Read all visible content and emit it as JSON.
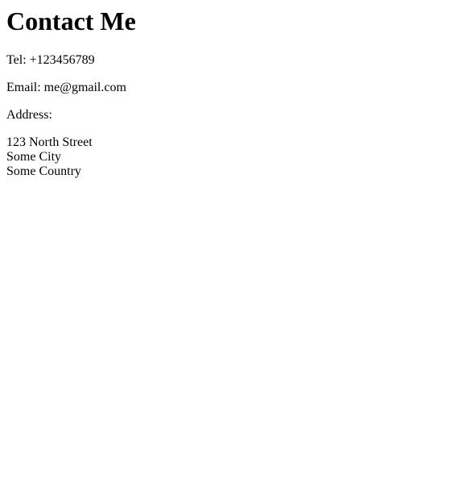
{
  "page": {
    "title": "Contact Me",
    "tel": "Tel: +123456789",
    "email": "Email: me@gmail.com",
    "address_label": "Address:",
    "address_lines": [
      "123 North Street",
      "Some City",
      "Some Country"
    ]
  }
}
